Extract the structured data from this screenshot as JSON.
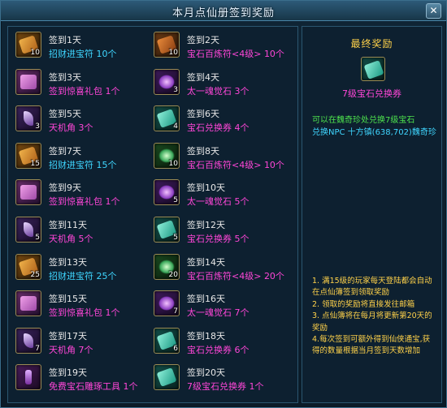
{
  "window": {
    "title": "本月点仙册签到奖励"
  },
  "rewards": [
    {
      "day": "签到1天",
      "item": "招财进宝符",
      "qty": "10个",
      "count": "10",
      "icon": "gold-ticket-icon",
      "style": "ic-gold",
      "color": "c-cyan"
    },
    {
      "day": "签到2天",
      "item": "宝石百炼符<4级>",
      "qty": "10个",
      "count": "10",
      "icon": "orange-ticket-icon",
      "style": "ic-orange",
      "color": "c-mag"
    },
    {
      "day": "签到3天",
      "item": "签到惊喜礼包",
      "qty": "1个",
      "count": "",
      "icon": "gift-bag-icon",
      "style": "ic-pink",
      "color": "c-mag"
    },
    {
      "day": "签到4天",
      "item": "太一魂觉石",
      "qty": "3个",
      "count": "3",
      "icon": "soul-stone-icon",
      "style": "ic-purple",
      "color": "c-mag"
    },
    {
      "day": "签到5天",
      "item": "天机角",
      "qty": "3个",
      "count": "3",
      "icon": "horn-icon",
      "style": "ic-horn",
      "color": "c-mag"
    },
    {
      "day": "签到6天",
      "item": "宝石兑换券",
      "qty": "4个",
      "count": "4",
      "icon": "gem-voucher-icon",
      "style": "ic-teal",
      "color": "c-mag"
    },
    {
      "day": "签到7天",
      "item": "招财进宝符",
      "qty": "15个",
      "count": "15",
      "icon": "gold-ticket-icon",
      "style": "ic-gold",
      "color": "c-cyan"
    },
    {
      "day": "签到8天",
      "item": "宝石百炼符<4级>",
      "qty": "10个",
      "count": "10",
      "icon": "green-talisman-icon",
      "style": "ic-green",
      "color": "c-mag"
    },
    {
      "day": "签到9天",
      "item": "签到惊喜礼包",
      "qty": "1个",
      "count": "",
      "icon": "gift-bag-icon",
      "style": "ic-pink",
      "color": "c-mag"
    },
    {
      "day": "签到10天",
      "item": "太一魂觉石",
      "qty": "5个",
      "count": "5",
      "icon": "soul-stone-icon",
      "style": "ic-purple",
      "color": "c-mag"
    },
    {
      "day": "签到11天",
      "item": "天机角",
      "qty": "5个",
      "count": "5",
      "icon": "horn-icon",
      "style": "ic-horn",
      "color": "c-mag"
    },
    {
      "day": "签到12天",
      "item": "宝石兑换券",
      "qty": "5个",
      "count": "5",
      "icon": "gem-voucher-icon",
      "style": "ic-teal",
      "color": "c-mag"
    },
    {
      "day": "签到13天",
      "item": "招财进宝符",
      "qty": "25个",
      "count": "25",
      "icon": "gold-ticket-icon",
      "style": "ic-gold",
      "color": "c-cyan"
    },
    {
      "day": "签到14天",
      "item": "宝石百炼符<4级>",
      "qty": "20个",
      "count": "20",
      "icon": "green-talisman-icon",
      "style": "ic-green",
      "color": "c-mag"
    },
    {
      "day": "签到15天",
      "item": "签到惊喜礼包",
      "qty": "1个",
      "count": "",
      "icon": "gift-bag-icon",
      "style": "ic-pink",
      "color": "c-mag"
    },
    {
      "day": "签到16天",
      "item": "太一魂觉石",
      "qty": "7个",
      "count": "7",
      "icon": "soul-stone-icon",
      "style": "ic-purple",
      "color": "c-mag"
    },
    {
      "day": "签到17天",
      "item": "天机角",
      "qty": "7个",
      "count": "7",
      "icon": "horn-icon",
      "style": "ic-horn",
      "color": "c-mag"
    },
    {
      "day": "签到18天",
      "item": "宝石兑换券",
      "qty": "6个",
      "count": "6",
      "icon": "gem-voucher-icon",
      "style": "ic-teal",
      "color": "c-mag"
    },
    {
      "day": "签到19天",
      "item": "免费宝石雕琢工具",
      "qty": "1个",
      "count": "",
      "icon": "carving-tool-icon",
      "style": "ic-tool",
      "color": "c-mag"
    },
    {
      "day": "签到20天",
      "item": "7级宝石兑换券",
      "qty": "1个",
      "count": "",
      "icon": "gem-voucher-icon",
      "style": "ic-teal",
      "color": "c-mag"
    }
  ],
  "final": {
    "title": "最终奖励",
    "item": "7级宝石兑换券",
    "exchange_line1": "可以在魏奇珍处兑换7级宝石",
    "exchange_line2": "兑换NPC 十方镇(638,702)魏奇珍"
  },
  "rules": [
    "1. 满15级的玩家每天登陆都会自动在点仙簿签到领取奖励",
    "2. 领取的奖励将直接发往邮箱",
    "3. 点仙簿将在每月将更新第20天的奖励",
    "4.每次签到可额外得到仙侠通宝,获得的数量根据当月签到天数增加"
  ],
  "colors": {
    "accent": "#ffd24a",
    "cyan": "#3fd6ff",
    "magenta": "#ff46d8",
    "green": "#4de24d"
  }
}
